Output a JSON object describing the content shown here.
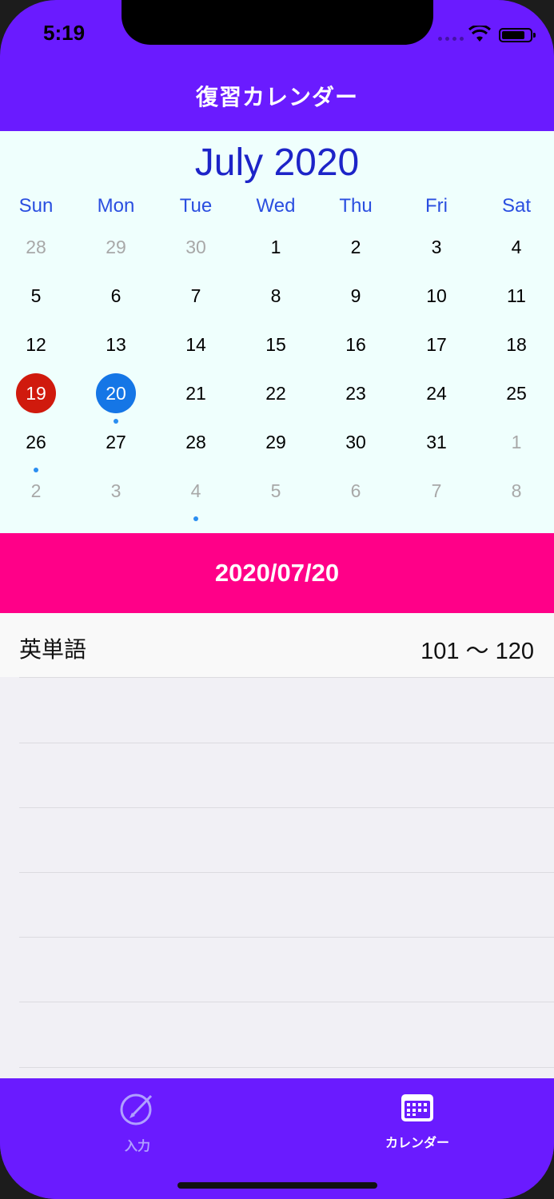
{
  "status_bar": {
    "time": "5:19"
  },
  "nav": {
    "title": "復習カレンダー"
  },
  "calendar": {
    "month_title": "July 2020",
    "weekdays": [
      "Sun",
      "Mon",
      "Tue",
      "Wed",
      "Thu",
      "Fri",
      "Sat"
    ],
    "weeks": [
      [
        "28",
        "29",
        "30",
        "1",
        "2",
        "3",
        "4"
      ],
      [
        "5",
        "6",
        "7",
        "8",
        "9",
        "10",
        "11"
      ],
      [
        "12",
        "13",
        "14",
        "15",
        "16",
        "17",
        "18"
      ],
      [
        "19",
        "20",
        "21",
        "22",
        "23",
        "24",
        "25"
      ],
      [
        "26",
        "27",
        "28",
        "29",
        "30",
        "31",
        "1"
      ],
      [
        "2",
        "3",
        "4",
        "5",
        "6",
        "7",
        "8"
      ]
    ],
    "today": "19",
    "selected": "20",
    "event_days": [
      "20",
      "26",
      "4 (Aug)"
    ],
    "colors": {
      "today": "#d01a0d",
      "selected": "#1576e6",
      "weekday_header": "#2a4ee0",
      "month_title": "#1d24c8",
      "event_dot": "#2a8ef0"
    }
  },
  "date_header": {
    "text": "2020/07/20",
    "color": "#ff0088"
  },
  "list": {
    "items": [
      {
        "title": "英単語",
        "range": "101 ～ 120"
      }
    ]
  },
  "tabbar": {
    "tabs": [
      {
        "label": "入力",
        "icon": "pencil-circle-icon",
        "active": false
      },
      {
        "label": "カレンダー",
        "icon": "calendar-icon",
        "active": true
      }
    ]
  },
  "theme": {
    "primary": "#6a1bff"
  }
}
